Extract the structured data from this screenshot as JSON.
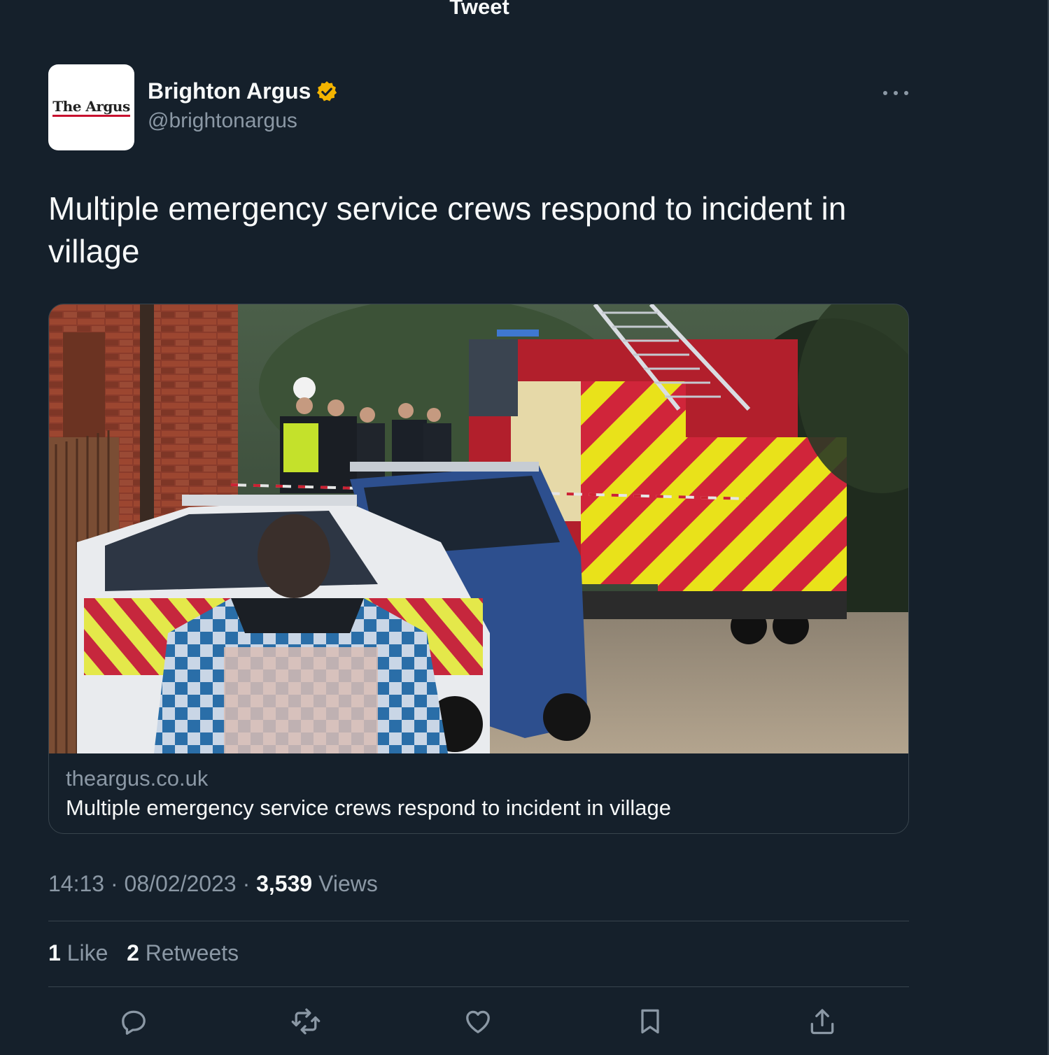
{
  "header": {
    "title": "Tweet"
  },
  "author": {
    "avatar_text": "The Argus",
    "name": "Brighton Argus",
    "handle": "@brightonargus",
    "verified": true,
    "verified_color": "#f4b400"
  },
  "tweet": {
    "text": "Multiple emergency service crews respond to incident in village"
  },
  "card": {
    "domain": "theargus.co.uk",
    "title": "Multiple emergency service crews respond to incident in village"
  },
  "meta": {
    "time": "14:13",
    "separator": "·",
    "date": "08/02/2023",
    "views_count": "3,539",
    "views_label": "Views"
  },
  "stats": {
    "likes_count": "1",
    "likes_label": "Like",
    "retweets_count": "2",
    "retweets_label": "Retweets"
  },
  "actions": [
    "reply-icon",
    "retweet-icon",
    "like-icon",
    "bookmark-icon",
    "share-icon"
  ],
  "colors": {
    "background": "#15202b",
    "text": "#f7f9f9",
    "secondary_text": "#8b98a5",
    "border": "#38444d"
  }
}
